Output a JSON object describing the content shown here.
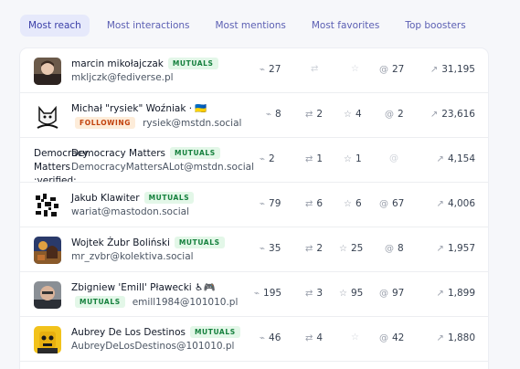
{
  "tabs": [
    {
      "label": "Most reach",
      "active": true
    },
    {
      "label": "Most interactions",
      "active": false
    },
    {
      "label": "Most mentions",
      "active": false
    },
    {
      "label": "Most favorites",
      "active": false
    },
    {
      "label": "Top boosters",
      "active": false
    }
  ],
  "rows": [
    {
      "name": "marcin mikołajczak",
      "badge": "MUTUALS",
      "handle": "mkljczk@fediverse.pl",
      "interactions": "27",
      "boosts": "",
      "favorites": "",
      "mentions": "27",
      "reach": "31,195"
    },
    {
      "name": "Michał \"rysiek\" Woźniak · 🇺🇦",
      "badge": "FOLLOWING",
      "handle": "rysiek@mstdn.social",
      "interactions": "8",
      "boosts": "2",
      "favorites": "4",
      "mentions": "2",
      "reach": "23,616"
    },
    {
      "name": "Democracy Matters",
      "avatar_alt": "Democracy Matters :verified:",
      "badge": "MUTUALS",
      "handle": "DemocracyMattersALot@mstdn.social",
      "interactions": "2",
      "boosts": "1",
      "favorites": "1",
      "mentions": "",
      "reach": "4,154"
    },
    {
      "name": "Jakub Klawiter",
      "badge": "MUTUALS",
      "handle": "wariat@mastodon.social",
      "interactions": "79",
      "boosts": "6",
      "favorites": "6",
      "mentions": "67",
      "reach": "4,006"
    },
    {
      "name": "Wojtek Żubr Boliński",
      "badge": "MUTUALS",
      "handle": "mr_zvbr@kolektiva.social",
      "interactions": "35",
      "boosts": "2",
      "favorites": "25",
      "mentions": "8",
      "reach": "1,957"
    },
    {
      "name": "Zbigniew 'Emill' Pławecki ♿🎮",
      "badge": "MUTUALS",
      "handle": "emill1984@101010.pl",
      "interactions": "195",
      "boosts": "3",
      "favorites": "95",
      "mentions": "97",
      "reach": "1,899"
    },
    {
      "name": "Aubrey De Los Destinos",
      "badge": "MUTUALS",
      "handle": "AubreyDeLosDestinos@101010.pl",
      "interactions": "46",
      "boosts": "4",
      "favorites": "",
      "mentions": "42",
      "reach": "1,880"
    }
  ],
  "icons": {
    "interactions": "activity-icon",
    "boosts": "boost-icon",
    "favorites": "star-icon",
    "mentions": "at-icon",
    "reach": "reach-icon"
  }
}
